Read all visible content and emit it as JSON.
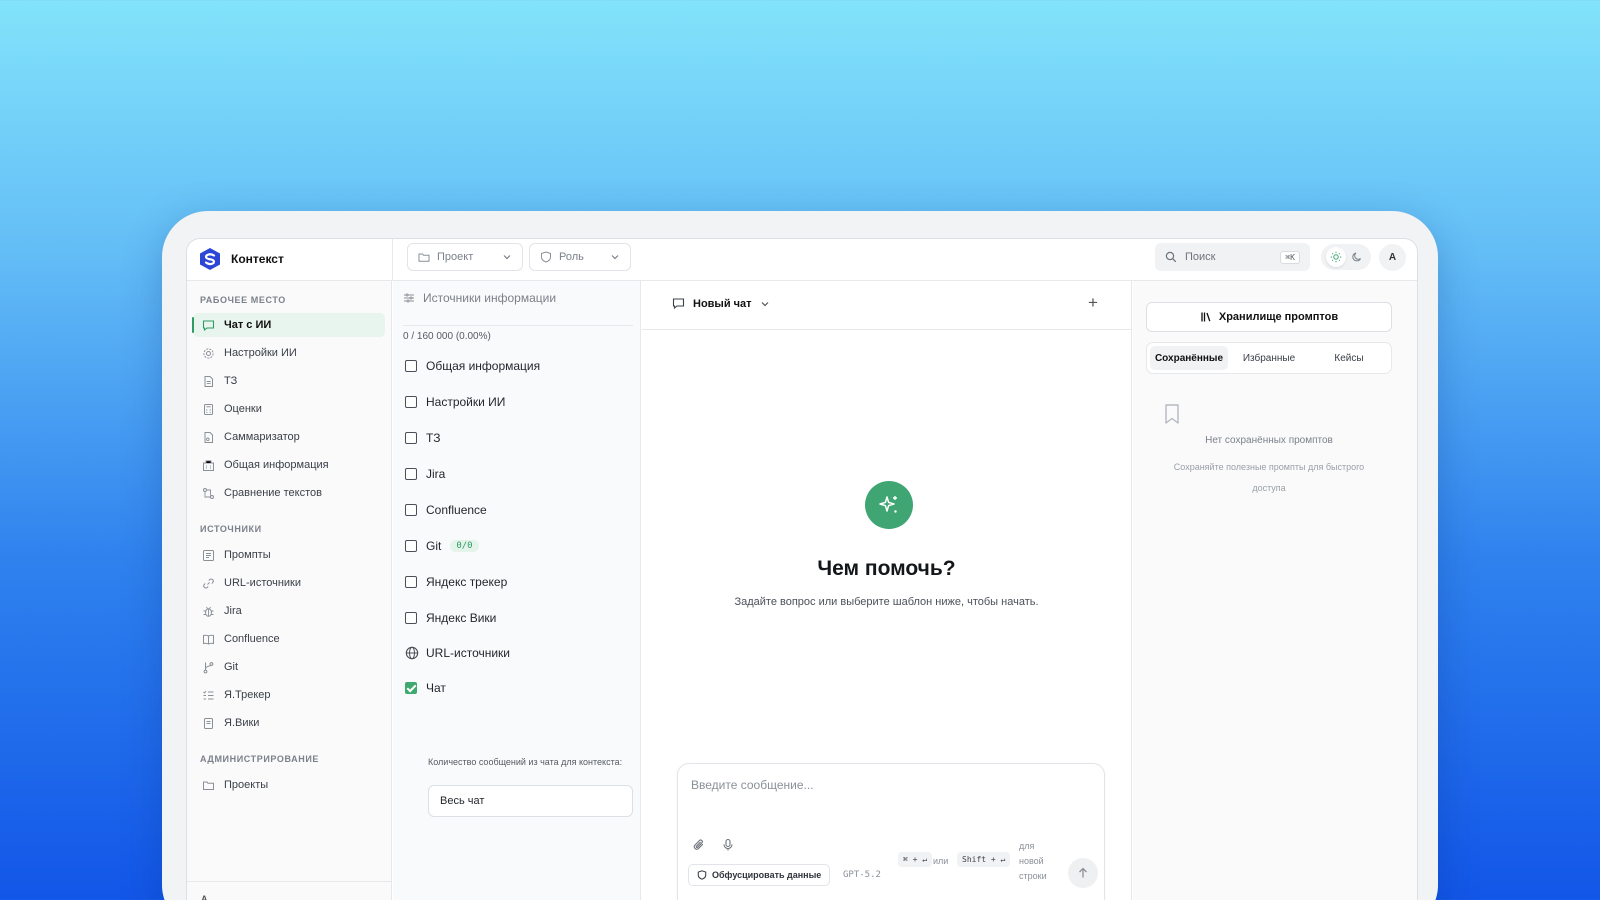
{
  "app": {
    "brand": "Контекст",
    "colors": {
      "accent": "#3fa572",
      "logo": "#2c46d6"
    }
  },
  "topbar": {
    "project_label": "Проект",
    "role_label": "Роль",
    "search_placeholder": "Поиск",
    "search_shortcut": "⌘K",
    "avatar": "A"
  },
  "sidebar": {
    "sections": [
      {
        "title": "РАБОЧЕЕ МЕСТО",
        "items": [
          {
            "label": "Чат с ИИ",
            "icon": "chat-icon",
            "active": true
          },
          {
            "label": "Настройки ИИ",
            "icon": "gear-icon"
          },
          {
            "label": "ТЗ",
            "icon": "document-icon"
          },
          {
            "label": "Оценки",
            "icon": "calculator-icon"
          },
          {
            "label": "Саммаризатор",
            "icon": "summary-icon"
          },
          {
            "label": "Общая информация",
            "icon": "building-icon"
          },
          {
            "label": "Сравнение текстов",
            "icon": "compare-icon"
          }
        ]
      },
      {
        "title": "ИСТОЧНИКИ",
        "items": [
          {
            "label": "Промпты",
            "icon": "prompts-icon"
          },
          {
            "label": "URL-источники",
            "icon": "link-icon"
          },
          {
            "label": "Jira",
            "icon": "bug-icon"
          },
          {
            "label": "Confluence",
            "icon": "book-icon"
          },
          {
            "label": "Git",
            "icon": "git-branch-icon"
          },
          {
            "label": "Я.Трекер",
            "icon": "list-icon"
          },
          {
            "label": "Я.Вики",
            "icon": "wiki-icon"
          }
        ]
      },
      {
        "title": "АДМИНИСТРИРОВАНИЕ",
        "items": [
          {
            "label": "Проекты",
            "icon": "folder-icon"
          }
        ]
      }
    ],
    "user_avatar": "A"
  },
  "sources": {
    "title": "Источники информации",
    "counter": "0 / 160 000 (0.00%)",
    "items": [
      {
        "label": "Общая информация",
        "checked": false
      },
      {
        "label": "Настройки ИИ",
        "checked": false
      },
      {
        "label": "ТЗ",
        "checked": false
      },
      {
        "label": "Jira",
        "checked": false
      },
      {
        "label": "Confluence",
        "checked": false
      },
      {
        "label": "Git",
        "checked": false,
        "badge": "0/0"
      },
      {
        "label": "Яндекс трекер",
        "checked": false
      },
      {
        "label": "Яндекс Вики",
        "checked": false
      },
      {
        "label": "URL-источники",
        "icon": "globe-icon"
      },
      {
        "label": "Чат",
        "checked": true
      }
    ],
    "message_count_label": "Количество сообщений из чата для контекста:",
    "message_count_value": "Весь чат"
  },
  "chat": {
    "title": "Новый чат",
    "hero_title": "Чем помочь?",
    "hero_subtitle": "Задайте вопрос или выберите шаблон ниже, чтобы начать.",
    "composer_placeholder": "Введите сообщение...",
    "obfuscate_label": "Обфусцировать данные",
    "model": "GPT-5.2",
    "send_shortcut": "⌘ + ↵",
    "or_text": "или",
    "newline_shortcut": "Shift + ↵",
    "newline_hint_1": "для",
    "newline_hint_2": "новой",
    "newline_hint_3": "строки"
  },
  "right_panel": {
    "store_button": "Хранилище промптов",
    "tabs": [
      "Сохранённые",
      "Избранные",
      "Кейсы"
    ],
    "active_tab": "Сохранённые",
    "empty_title": "Нет сохранённых промптов",
    "empty_subtitle": "Сохраняйте полезные промпты для быстрого доступа"
  }
}
